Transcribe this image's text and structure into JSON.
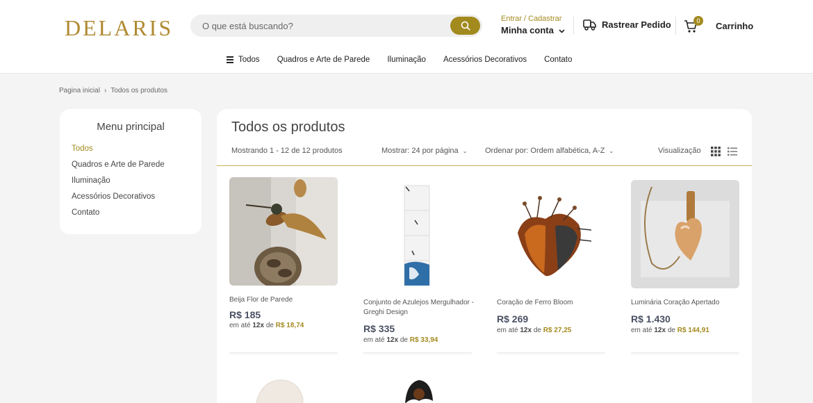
{
  "header": {
    "logo": "DELARIS",
    "search_placeholder": "O que está buscando?",
    "account_top": "Entrar / Cadastrar",
    "account_main": "Minha conta",
    "track_label": "Rastrear Pedido",
    "cart_count": "0",
    "cart_label": "Carrinho",
    "nav": [
      "Todos",
      "Quadros e Arte de Parede",
      "Iluminação",
      "Acessórios Decorativos",
      "Contato"
    ]
  },
  "breadcrumb": [
    "Pagina inicial",
    "Todos os produtos"
  ],
  "sidebar": {
    "title": "Menu principal",
    "items": [
      "Todos",
      "Quadros e Arte de Parede",
      "Iluminação",
      "Acessórios Decorativos",
      "Contato"
    ],
    "active_index": 0
  },
  "main": {
    "title": "Todos os produtos",
    "count_text": "Mostrando 1 - 12 de 12 produtos",
    "show_text": "Mostrar: 24 por página",
    "order_text": "Ordenar por: Ordem alfabética, A-Z",
    "view_label": "Visualização"
  },
  "products": [
    {
      "name": "Beija Flor de Parede",
      "price": "R$ 185",
      "inst_prefix": "em até",
      "inst_times": "12x",
      "inst_mid": "de",
      "inst_value": "R$ 18,74"
    },
    {
      "name": "Conjunto de Azulejos Mergulhador - Greghi Design",
      "price": "R$ 335",
      "inst_prefix": "em até",
      "inst_times": "12x",
      "inst_mid": "de",
      "inst_value": "R$ 33,94"
    },
    {
      "name": "Coração de Ferro Bloom",
      "price": "R$ 269",
      "inst_prefix": "em até",
      "inst_times": "12x",
      "inst_mid": "de",
      "inst_value": "R$ 27,25"
    },
    {
      "name": "Luminária Coração Apertado",
      "price": "R$ 1.430",
      "inst_prefix": "em até",
      "inst_times": "12x",
      "inst_mid": "de",
      "inst_value": "R$ 144,91"
    }
  ],
  "colors": {
    "accent": "#a38a1f",
    "logo": "#b08a32",
    "price": "#4a5063",
    "background": "#f4f4f4"
  },
  "icons": [
    "search-icon",
    "truck-icon",
    "cart-icon",
    "menu-icon",
    "chevron-down-icon",
    "grid-view-icon",
    "list-view-icon"
  ]
}
